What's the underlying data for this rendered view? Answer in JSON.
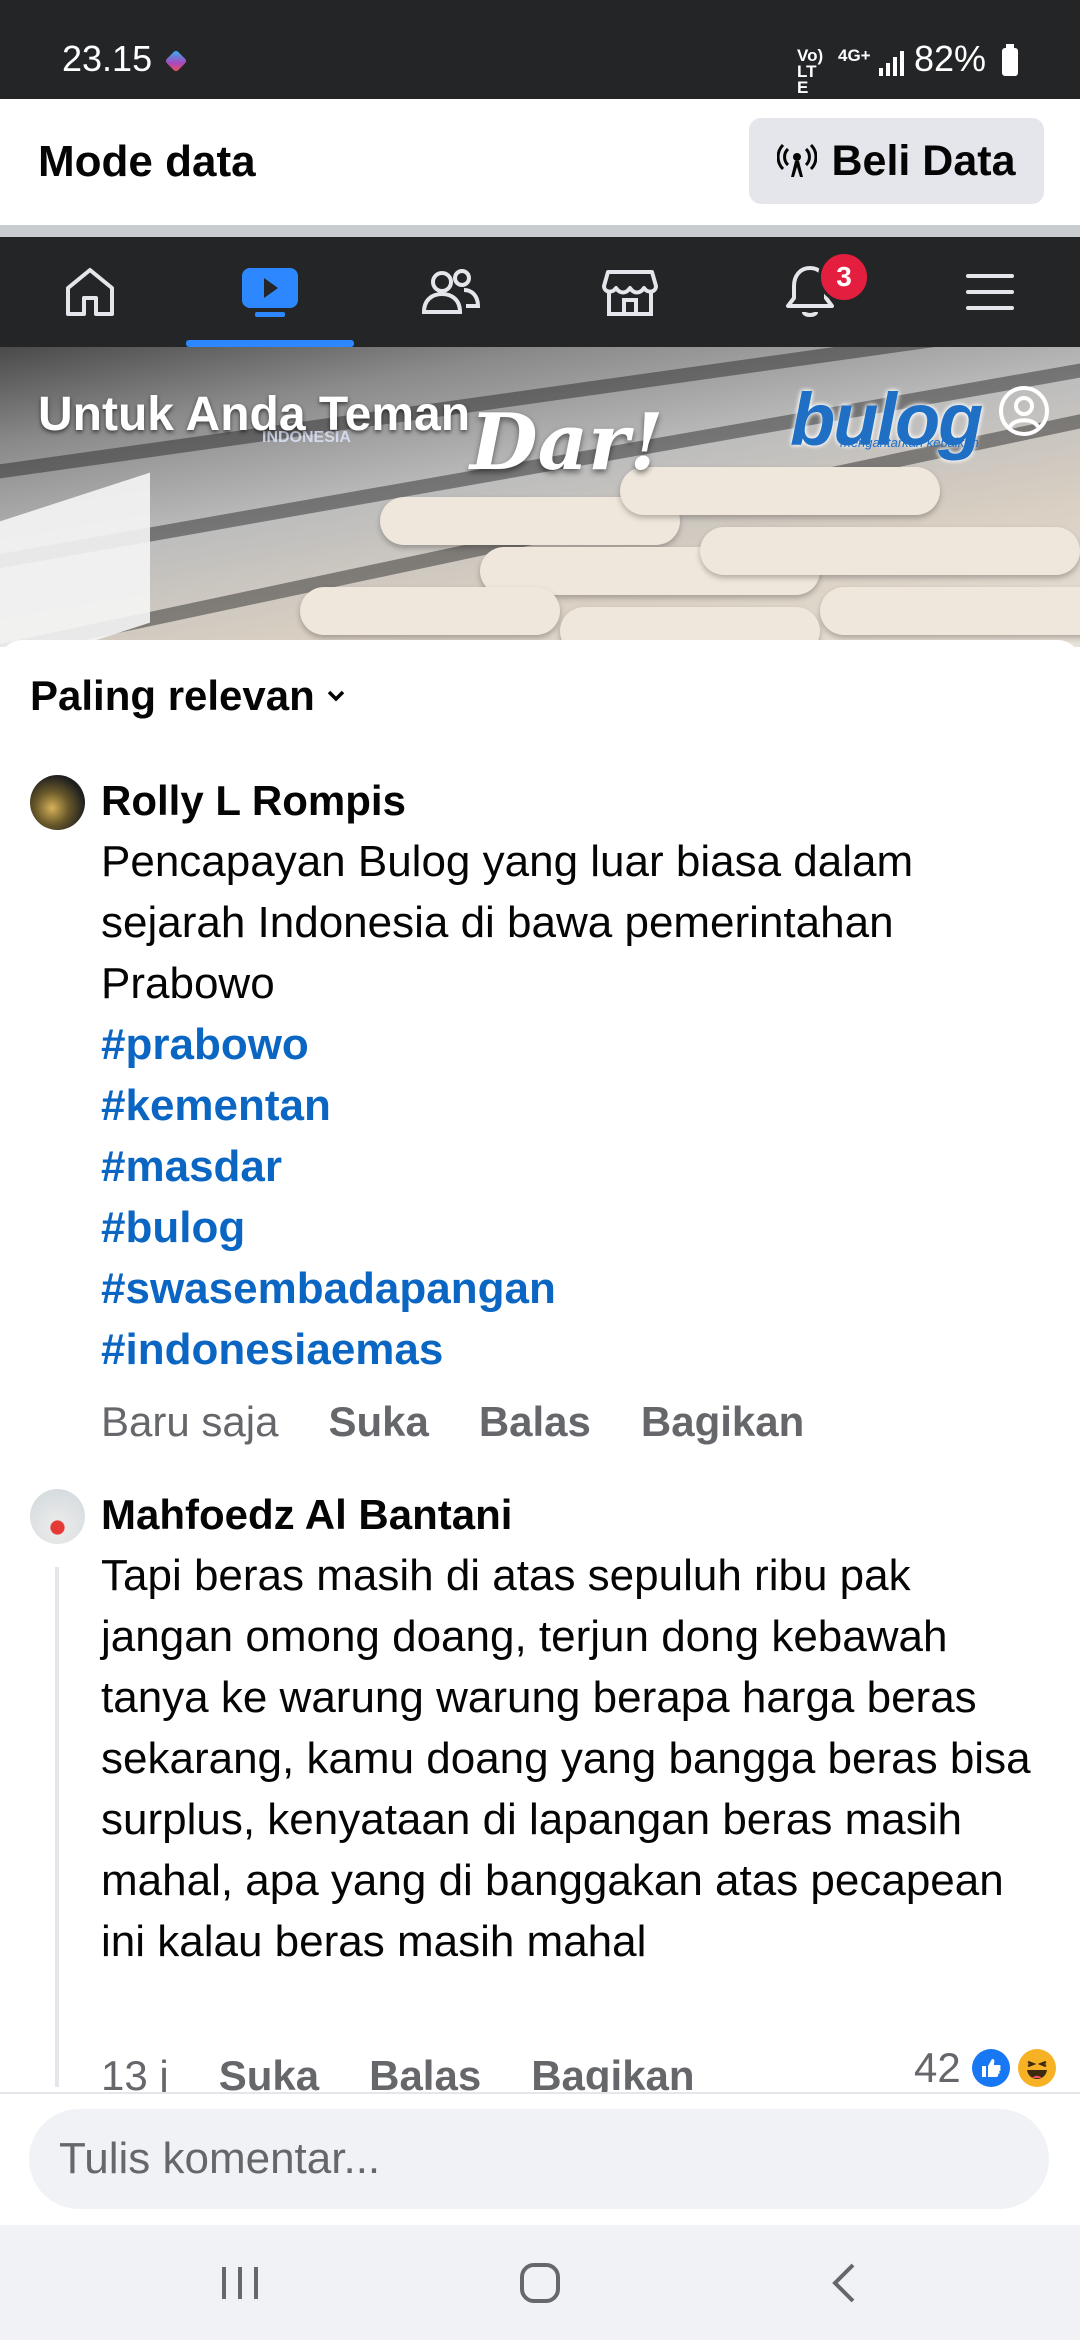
{
  "status_bar": {
    "time": "23.15",
    "network_label": "Vo) LTE",
    "network_type": "4G+",
    "battery_percent": "82%",
    "battery_level": 0.82
  },
  "mode_bar": {
    "title": "Mode data",
    "buy_button_label": "Beli Data",
    "buy_button_icon": "broadcast-icon"
  },
  "nav": {
    "tabs": [
      {
        "icon": "home-icon",
        "active": false
      },
      {
        "icon": "video-icon",
        "active": true
      },
      {
        "icon": "friends-icon",
        "active": false
      },
      {
        "icon": "marketplace-icon",
        "active": false
      },
      {
        "icon": "bell-icon",
        "active": false,
        "badge": "3"
      },
      {
        "icon": "menu-icon",
        "active": false
      }
    ],
    "active_color": "#2d88ff"
  },
  "video": {
    "overlay_text": "Untuk Anda Teman",
    "watermark_text": "INDONESIA",
    "brand_text": "Dar!",
    "logo_text": "bulog",
    "logo_tagline": "mengantarkan kebaikan"
  },
  "comments": {
    "sort_label": "Paling relevan",
    "items": [
      {
        "author": "Rolly L Rompis",
        "text": "Pencapayan Bulog yang luar biasa dalam sejarah Indonesia di bawa pemerintahan Prabowo",
        "hashtags": [
          "#prabowo",
          "#kementan",
          "#masdar",
          "#bulog",
          "#swasembadapangan",
          "#indonesiaemas"
        ],
        "time": "Baru saja",
        "actions": [
          "Suka",
          "Balas",
          "Bagikan"
        ]
      },
      {
        "author": "Mahfoedz Al Bantani",
        "text": "Tapi beras masih di atas sepuluh ribu pak jangan omong doang, terjun dong kebawah tanya ke warung warung berapa harga beras sekarang, kamu doang yang bangga beras bisa surplus, kenyataan di lapangan beras masih mahal, apa yang di banggakan atas pecapean ini kalau beras masih mahal",
        "time": "13 j",
        "actions": [
          "Suka",
          "Balas",
          "Bagikan"
        ],
        "reaction_count": "42",
        "reactions": [
          "like-icon",
          "haha-icon"
        ]
      }
    ]
  },
  "composer": {
    "placeholder": "Tulis komentar..."
  },
  "system_nav": {
    "buttons": [
      "recents-icon",
      "home-circle-icon",
      "back-icon"
    ]
  }
}
